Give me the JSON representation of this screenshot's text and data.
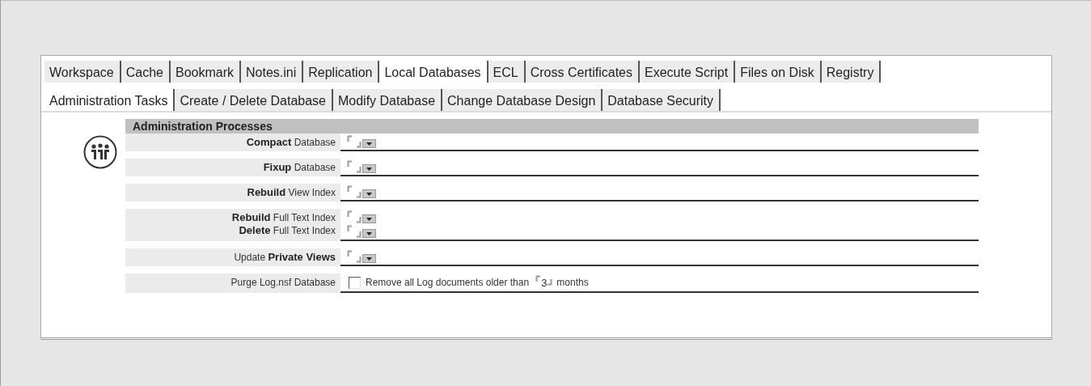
{
  "tabs": [
    {
      "label": "Workspace",
      "selected": false
    },
    {
      "label": "Cache",
      "selected": false
    },
    {
      "label": "Bookmark",
      "selected": false
    },
    {
      "label": "Notes.ini",
      "selected": false
    },
    {
      "label": "Replication",
      "selected": false
    },
    {
      "label": "Local Databases",
      "selected": true
    },
    {
      "label": "ECL",
      "selected": false
    },
    {
      "label": "Cross Certificates",
      "selected": false
    },
    {
      "label": "Execute Script",
      "selected": false
    },
    {
      "label": "Files on Disk",
      "selected": false
    },
    {
      "label": "Registry",
      "selected": false
    }
  ],
  "subtabs": [
    {
      "label": "Administration Tasks",
      "selected": true
    },
    {
      "label": "Create / Delete Database",
      "selected": false
    },
    {
      "label": "Modify Database",
      "selected": false
    },
    {
      "label": "Change Database Design",
      "selected": false
    },
    {
      "label": "Database Security",
      "selected": false
    }
  ],
  "section": {
    "title": "Administration Processes"
  },
  "rows": [
    {
      "kind": "dropdown",
      "lines": [
        "**Compact** Database"
      ]
    },
    {
      "kind": "dropdown",
      "lines": [
        "**Fixup** Database"
      ]
    },
    {
      "kind": "dropdown",
      "lines": [
        "**Rebuild** View Index"
      ]
    },
    {
      "kind": "dropdown",
      "lines": [
        "**Rebuild** Full Text Index",
        "**Delete** Full Text Index"
      ]
    },
    {
      "kind": "dropdown",
      "lines": [
        "Update **Private Views**"
      ]
    },
    {
      "kind": "checkbox",
      "lines": [
        "Purge Log.nsf Database"
      ],
      "checked": false,
      "text": "Remove all Log documents older than",
      "value": "3",
      "suffix": "months"
    }
  ]
}
